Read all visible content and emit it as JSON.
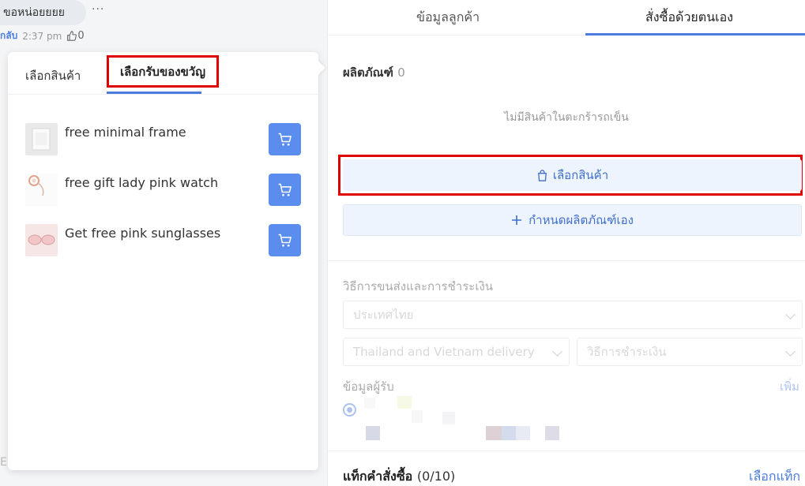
{
  "chat": {
    "bubble_text": "ขอหน่อยยยย",
    "more": "···",
    "back_link": "กลับ",
    "time": "2:37 pm",
    "like_count": "0",
    "input_hint": "E"
  },
  "popup": {
    "tabs": [
      "เลือกสินค้า",
      "เลือกรับของขวัญ"
    ],
    "products": [
      {
        "name": "free minimal frame",
        "thumb": "frame"
      },
      {
        "name": "free gift lady pink watch",
        "thumb": "watch"
      },
      {
        "name": "Get free pink sunglasses",
        "thumb": "sunglasses"
      }
    ]
  },
  "right": {
    "tabs": [
      "ข้อมูลลูกค้า",
      "สั่งซื้อด้วยตนเอง"
    ],
    "products_label": "ผลิตภัณฑ์",
    "products_count": "0",
    "empty_text": "ไม่มีสินค้าในตะกร้ารถเข็น",
    "select_product": "เลือกสินค้า",
    "custom_product": "กำหนดผลิตภัณฑ์เอง",
    "shipping_label": "วิธีการขนส่งและการชำระเงิน",
    "country_value": "ประเทศไทย",
    "delivery_value": "Thailand and Vietnam delivery",
    "payment_placeholder": "วิธีการชำระเงิน",
    "recipient_label": "ข้อมูลผู้รับ",
    "add_link": "เพิ่ม",
    "order_tags_label": "แท็กคำสั่งซื้อ",
    "order_tags_count": "(0/10)",
    "select_tag": "เลือกแท็ก"
  },
  "colors": {
    "accent": "#4a7ce0",
    "cart_button": "#5b8def",
    "highlight": "#e00000"
  }
}
